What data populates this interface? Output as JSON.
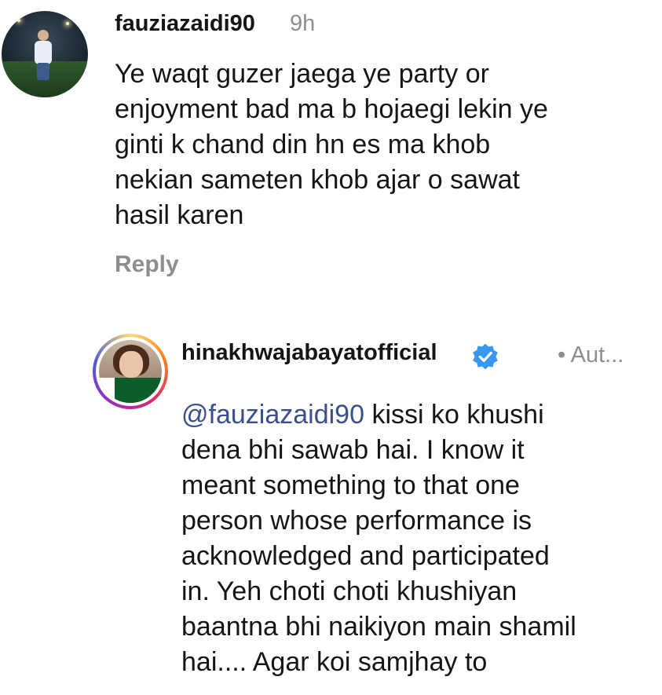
{
  "comment": {
    "username": "fauziazaidi90",
    "time": "9h",
    "text": "Ye waqt guzer jaega ye party or\nenjoyment bad ma b hojaegi lekin ye\nginti k chand din hn es ma khob\nnekian sameten khob ajar o sawat\nhasil karen",
    "reply_label": "Reply"
  },
  "reply_comment": {
    "username": "hinakhwajabayatofficial",
    "author_badge": "• Aut...",
    "mention": "@fauziazaidi90",
    "text": " kissi ko khushi\ndena bhi sawab hai. I know it\nmeant something to that one\nperson whose performance is\nacknowledged and participated\nin. Yeh choti choti khushiyan\nbaantna bhi naikiyon main shamil\nhai.... Agar koi samjhay to"
  },
  "icons": {
    "verified": "verified-badge-icon"
  },
  "colors": {
    "verified": "#3897f0",
    "mention": "#3b4f8a",
    "secondary_text": "#8e8e8e"
  }
}
